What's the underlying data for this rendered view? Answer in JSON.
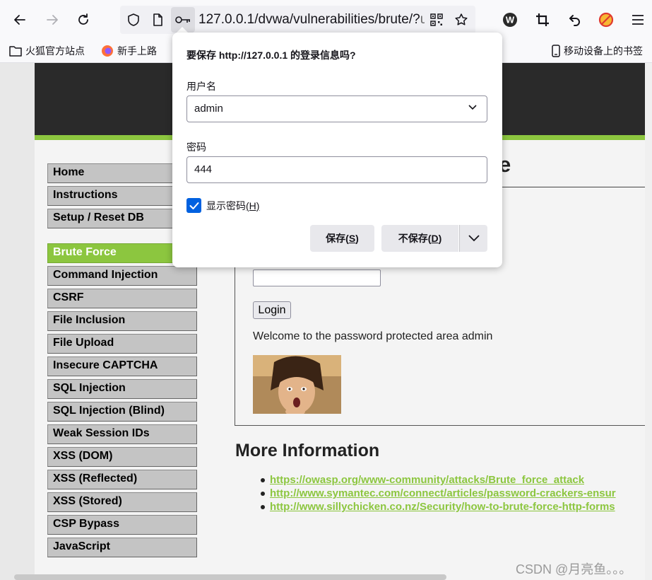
{
  "browser": {
    "url_main": "127.0.0.1/dvwa/vulnerabilities/brute/?",
    "url_dim": "u",
    "icons": [
      "back-arrow-icon",
      "forward-arrow-icon",
      "reload-icon",
      "shield-icon",
      "page-icon",
      "key-icon",
      "qr-code-icon",
      "star-icon",
      "wordpress-icon",
      "crop-icon",
      "undo-icon",
      "no-bug-icon",
      "menu-icon"
    ]
  },
  "bookmarks": {
    "items": [
      {
        "label": "火狐官方站点",
        "icon": "folder-icon"
      },
      {
        "label": "新手上路",
        "icon": "firefox-icon"
      }
    ],
    "mobile": "移动设备上的书签"
  },
  "popup": {
    "title": "要保存 http://127.0.0.1 的登录信息吗?",
    "username_label": "用户名",
    "username_value": "admin",
    "password_label": "密码",
    "password_value": "444",
    "show_password_label": "显示密码",
    "show_password_key": "(H)",
    "show_password_checked": true,
    "save_label": "保存(S)",
    "save_key": "S",
    "dont_save_label": "不保存(D)",
    "dont_save_key": "D"
  },
  "menu": {
    "groups": [
      [
        "Home",
        "Instructions",
        "Setup / Reset DB"
      ],
      [
        "Brute Force",
        "Command Injection",
        "CSRF",
        "File Inclusion",
        "File Upload",
        "Insecure CAPTCHA",
        "SQL Injection",
        "SQL Injection (Blind)",
        "Weak Session IDs",
        "XSS (DOM)",
        "XSS (Reflected)",
        "XSS (Stored)",
        "CSP Bypass",
        "JavaScript"
      ]
    ],
    "active": "Brute Force"
  },
  "main": {
    "title_partial": "e",
    "login_button": "Login",
    "welcome": "Welcome to the password protected area admin",
    "more_info": "More Information",
    "links": [
      "https://owasp.org/www-community/attacks/Brute_force_attack",
      "http://www.symantec.com/connect/articles/password-crackers-ensur",
      "http://www.sillychicken.co.nz/Security/how-to-brute-force-http-forms"
    ]
  },
  "watermark": "CSDN @月亮鱼。。。",
  "colors": {
    "accent_green": "#8cc63f",
    "header_dark": "#2a2a2a",
    "checkbox_blue": "#0061e0"
  }
}
